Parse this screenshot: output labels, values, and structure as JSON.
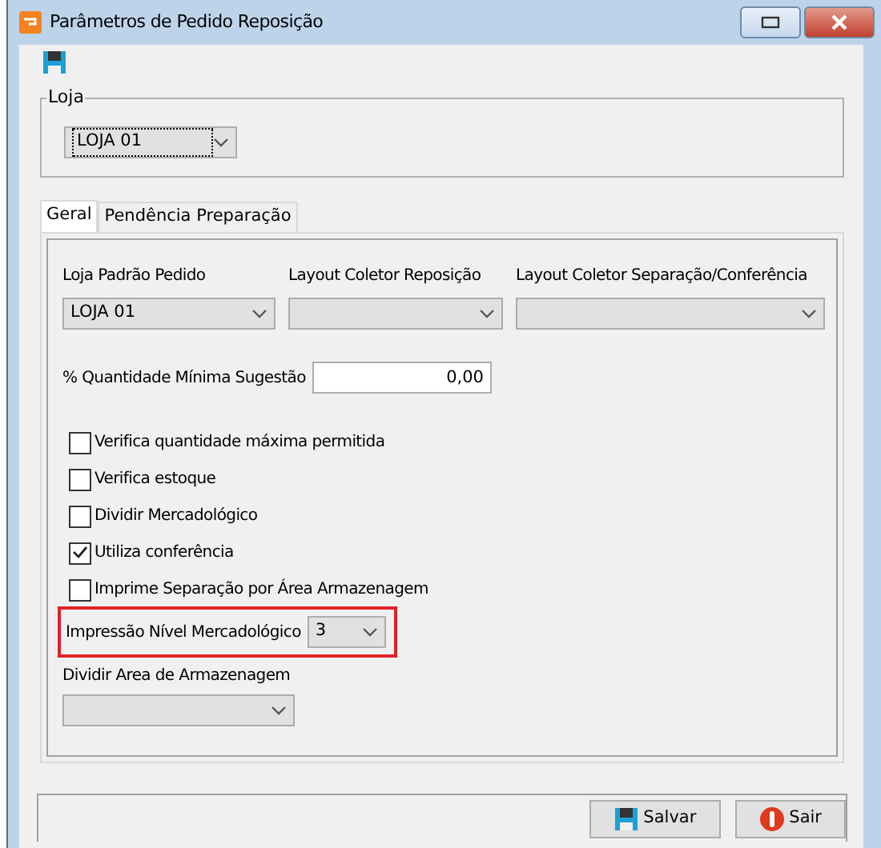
{
  "window": {
    "title": "Parâmetros de Pedido Reposição"
  },
  "loja_group": {
    "label": "Loja",
    "combo": {
      "value": "LOJA 01",
      "focused": true
    }
  },
  "tabs": [
    {
      "label": "Geral",
      "selected": true
    },
    {
      "label": "Pendência Preparação",
      "selected": false
    }
  ],
  "combos": [
    {
      "label": "Loja Padrão Pedido",
      "value": "LOJA 01"
    },
    {
      "label": "Layout Coletor Reposição"
    },
    {
      "label": "Layout Coletor Separação/Conferência"
    }
  ],
  "quantity_field": {
    "label": "% Quantidade Mínima Sugestão",
    "value": "0,00"
  },
  "checkboxes": [
    {
      "label": "Verifica quantidade máxima permitida",
      "checked": false
    },
    {
      "label": "Verifica estoque",
      "checked": false
    },
    {
      "label": "Dividir Mercadológico",
      "checked": false
    },
    {
      "label": "Utiliza conferência",
      "checked": true
    },
    {
      "label": "Imprime Separação por Área Armazenagem",
      "checked": false
    }
  ],
  "nivel_field": {
    "label": "Impressão Nível Mercadológico",
    "value": "3",
    "highlighted": true
  },
  "area_field": {
    "label": "Dividir Area de Armazenagem"
  },
  "buttons": [
    {
      "label": "Salvar",
      "kind": "save"
    },
    {
      "label": "Sair",
      "kind": "exit"
    }
  ]
}
